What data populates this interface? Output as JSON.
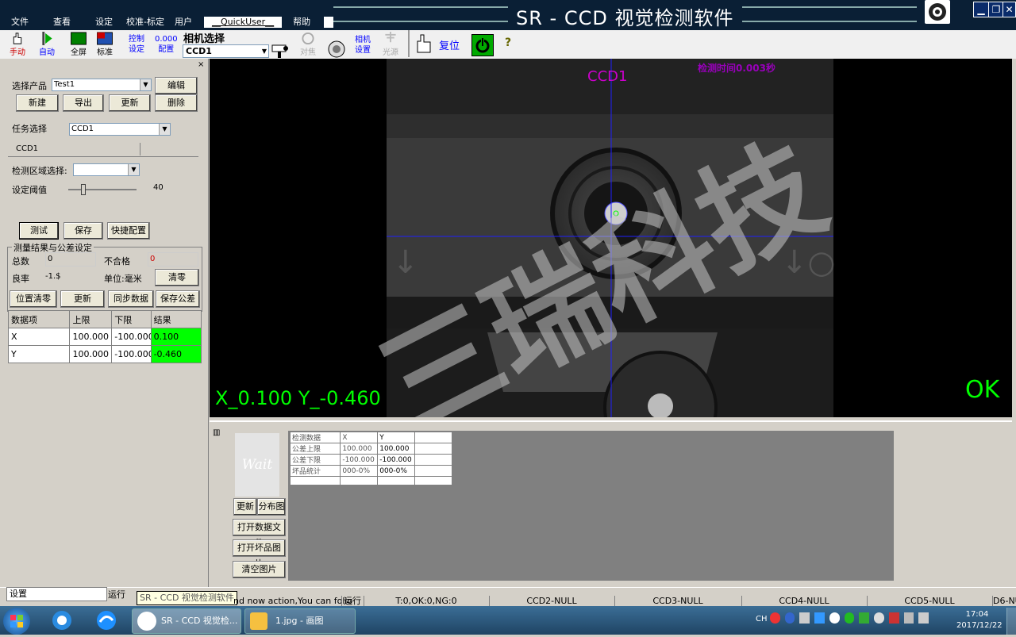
{
  "window": {
    "title": "SR - CCD 视觉检测软件",
    "menu": [
      "文件",
      "查看",
      "设定",
      "校准-标定",
      "用户",
      "__QuickUser__",
      "帮助"
    ]
  },
  "toolbar": {
    "manual": "手动",
    "auto": "自动",
    "fullscreen": "全屏",
    "standard": "标准",
    "control_l1": "控制",
    "control_l2": "设定",
    "config_value": "0.000",
    "config_label": "配置",
    "camera_select_label": "相机选择",
    "camera_select_value": "CCD1",
    "focus": "对焦",
    "camera_settings_l1": "相机",
    "camera_settings_l2": "设置",
    "light_source": "光源",
    "reset": "复位",
    "help_glyph": "?"
  },
  "left_panel": {
    "product_label": "选择产品",
    "product_value": "Test1",
    "edit_button": "编辑",
    "new_button": "新建",
    "export_button": "导出",
    "update_button": "更新",
    "delete_button": "删除",
    "task_label": "任务选择",
    "task_value": "CCD1",
    "tab_label": "CCD1",
    "region_label": "检测区域选择:",
    "region_value": "",
    "threshold_label": "设定阈值",
    "threshold_value": "40",
    "threshold_fraction": 0.2,
    "test_button": "测试",
    "save_button": "保存",
    "quick_config_button": "快捷配置",
    "results_group_title": "测量结果与公差设定",
    "total_label": "总数",
    "total_value": "0",
    "fail_label": "不合格",
    "fail_value": "0",
    "yield_label": "良率",
    "yield_value": "-1.$",
    "unit_label": "单位:毫米",
    "clear_button": "清零",
    "position_clear_button": "位置清零",
    "update2_button": "更新",
    "sync_data_button": "同步数据",
    "save_tolerance_button": "保存公差",
    "table": {
      "headers": [
        "数据项",
        "上限",
        "下限",
        "结果"
      ],
      "rows": [
        [
          "X",
          "100.000",
          "-100.000",
          "0.100"
        ],
        [
          "Y",
          "100.000",
          "-100.000",
          "-0.460"
        ]
      ]
    }
  },
  "camera_view": {
    "title": "CCD1",
    "detection_time": "检测时间0.003秒",
    "coordinates": "X_0.100 Y_-0.460",
    "status": "OK",
    "watermark": "三瑞科技"
  },
  "info_panel": {
    "wait_text": "Wait",
    "update_button": "更新",
    "distribution_button": "分布图",
    "open_data_file_button": "打开数据文件",
    "open_bad_image_button": "打开坏品图片",
    "clear_images_button": "清空图片",
    "table": {
      "headers": [
        "检测数据",
        "X",
        "Y"
      ],
      "rows": [
        [
          "公差上限",
          "100.000",
          "100.000"
        ],
        [
          "公差下限",
          "-100.000",
          "-100.000"
        ],
        [
          "坏品统计",
          "000-0%",
          "000-0%"
        ]
      ]
    }
  },
  "status_bar": {
    "settings_tab": "设置",
    "run_tab": "运行",
    "tooltip": "SR - CCD 视觉检测软件",
    "message": "nd now action,You can follo",
    "run_label": "运行",
    "counts": "T:0,OK:0,NG:0",
    "ccd2": "CCD2-NULL",
    "ccd3": "CCD3-NULL",
    "ccd4": "CCD4-NULL",
    "ccd5": "CCD5-NULL",
    "ccd6": "D6-NU"
  },
  "taskbar": {
    "app1": "SR - CCD 视觉检...",
    "app2": "1.jpg - 画图",
    "lang": "CH",
    "time": "17:04",
    "date": "2017/12/22"
  },
  "colors": {
    "accent_magenta": "#cc00cc",
    "ok_green": "#00ff00",
    "result_green": "#00ff00",
    "crosshair_blue": "#2020ff",
    "titlebar": "#0a1f35"
  }
}
